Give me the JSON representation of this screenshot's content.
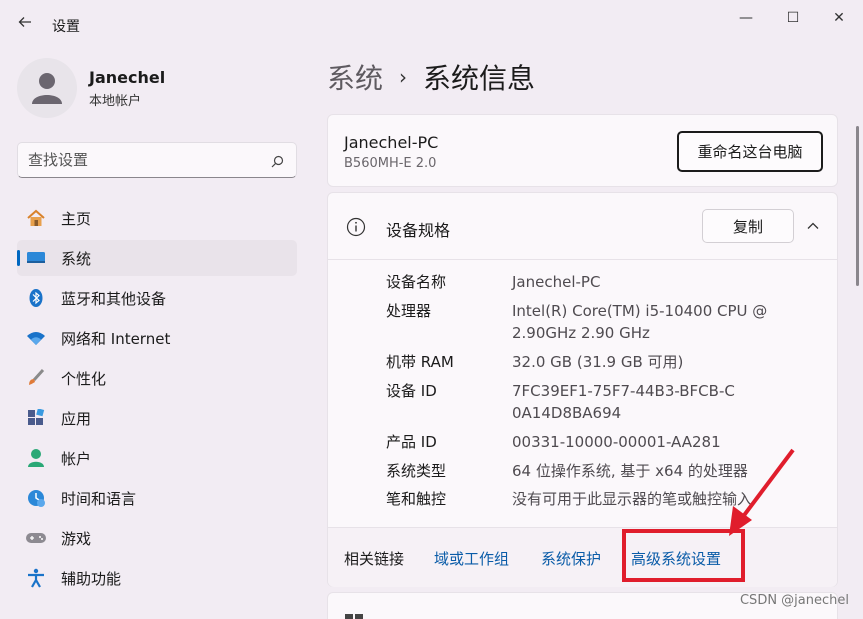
{
  "window": {
    "title": "设置",
    "back_icon": "back-arrow-icon",
    "minimize_glyph": "—",
    "maximize_glyph": "☐",
    "close_glyph": "✕"
  },
  "profile": {
    "name": "Janechel",
    "account_type": "本地帐户"
  },
  "search": {
    "placeholder": "查找设置"
  },
  "sidebar": {
    "items": [
      {
        "label": "主页",
        "icon": "home-icon",
        "active": false
      },
      {
        "label": "系统",
        "icon": "system-icon",
        "active": true
      },
      {
        "label": "蓝牙和其他设备",
        "icon": "bluetooth-icon",
        "active": false
      },
      {
        "label": "网络和 Internet",
        "icon": "wifi-icon",
        "active": false
      },
      {
        "label": "个性化",
        "icon": "brush-icon",
        "active": false
      },
      {
        "label": "应用",
        "icon": "apps-icon",
        "active": false
      },
      {
        "label": "帐户",
        "icon": "account-icon",
        "active": false
      },
      {
        "label": "时间和语言",
        "icon": "time-language-icon",
        "active": false
      },
      {
        "label": "游戏",
        "icon": "gamepad-icon",
        "active": false
      },
      {
        "label": "辅助功能",
        "icon": "accessibility-icon",
        "active": false
      }
    ]
  },
  "breadcrumb": {
    "parent": "系统",
    "separator": "›",
    "current": "系统信息"
  },
  "pc_card": {
    "name": "Janechel-PC",
    "model": "B560MH-E 2.0",
    "rename_label": "重命名这台电脑"
  },
  "spec": {
    "title": "设备规格",
    "copy_label": "复制",
    "rows": [
      {
        "key": "设备名称",
        "value": "Janechel-PC"
      },
      {
        "key": "处理器",
        "value": "Intel(R) Core(TM) i5-10400 CPU @ 2.90GHz   2.90 GHz"
      },
      {
        "key": "机带 RAM",
        "value": "32.0 GB (31.9 GB 可用)"
      },
      {
        "key": "设备 ID",
        "value": "7FC39EF1-75F7-44B3-BFCB-C0A14D8BA694"
      },
      {
        "key": "产品 ID",
        "value": "00331-10000-00001-AA281"
      },
      {
        "key": "系统类型",
        "value": "64 位操作系统, 基于 x64 的处理器"
      },
      {
        "key": "笔和触控",
        "value": "没有可用于此显示器的笔或触控输入"
      }
    ]
  },
  "related": {
    "label": "相关链接",
    "links": [
      "域或工作组",
      "系统保护",
      "高级系统设置"
    ]
  },
  "annotation_color": "#e01d2c",
  "accent_color": "#0067c0",
  "watermark": "CSDN @janechel"
}
